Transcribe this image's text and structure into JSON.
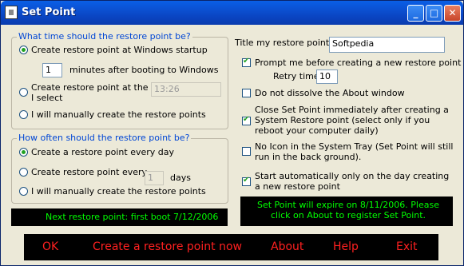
{
  "window": {
    "title": "Set Point",
    "min_label": "_",
    "max_label": "□",
    "close_label": "✕"
  },
  "restore_time": {
    "group_label": "What time should the restore point be?",
    "opt_startup": "Create restore point at Windows startup",
    "minutes_value": "1",
    "minutes_label": "minutes after booting to Windows",
    "opt_time_line1": "Create restore point at the time",
    "opt_time_line2": "I select",
    "time_value": "13:26",
    "opt_manual": "I will manually create the restore points"
  },
  "frequency": {
    "group_label": "How often should the restore point be?",
    "opt_every_day": "Create a restore point every day",
    "opt_every_n": "Create restore point every",
    "days_value": "1",
    "days_label": "days",
    "opt_manual": "I will manually create the restore points"
  },
  "next_restore": "Next restore point: first boot 7/12/2006",
  "options": {
    "title_label": "Title my restore points:",
    "title_value": "Softpedia",
    "prompt_label": "Prompt me before creating a new restore point",
    "retry_label": "Retry time",
    "retry_value": "10",
    "no_dissolve_label": "Do not dissolve the About window",
    "close_after_label": "Close Set Point immediately after creating a System Restore point (select only if you reboot your computer daily)",
    "no_tray_label": "No Icon in the System Tray (Set Point will still run in the back ground).",
    "start_auto_label": "Start automatically only on the day creating a new restore point"
  },
  "expire_notice": "Set Point will expire on 8/11/2006. Please click on About to register Set Point.",
  "buttons": {
    "ok": "OK",
    "create": "Create a restore point now",
    "about": "About",
    "help": "Help",
    "exit": "Exit"
  }
}
